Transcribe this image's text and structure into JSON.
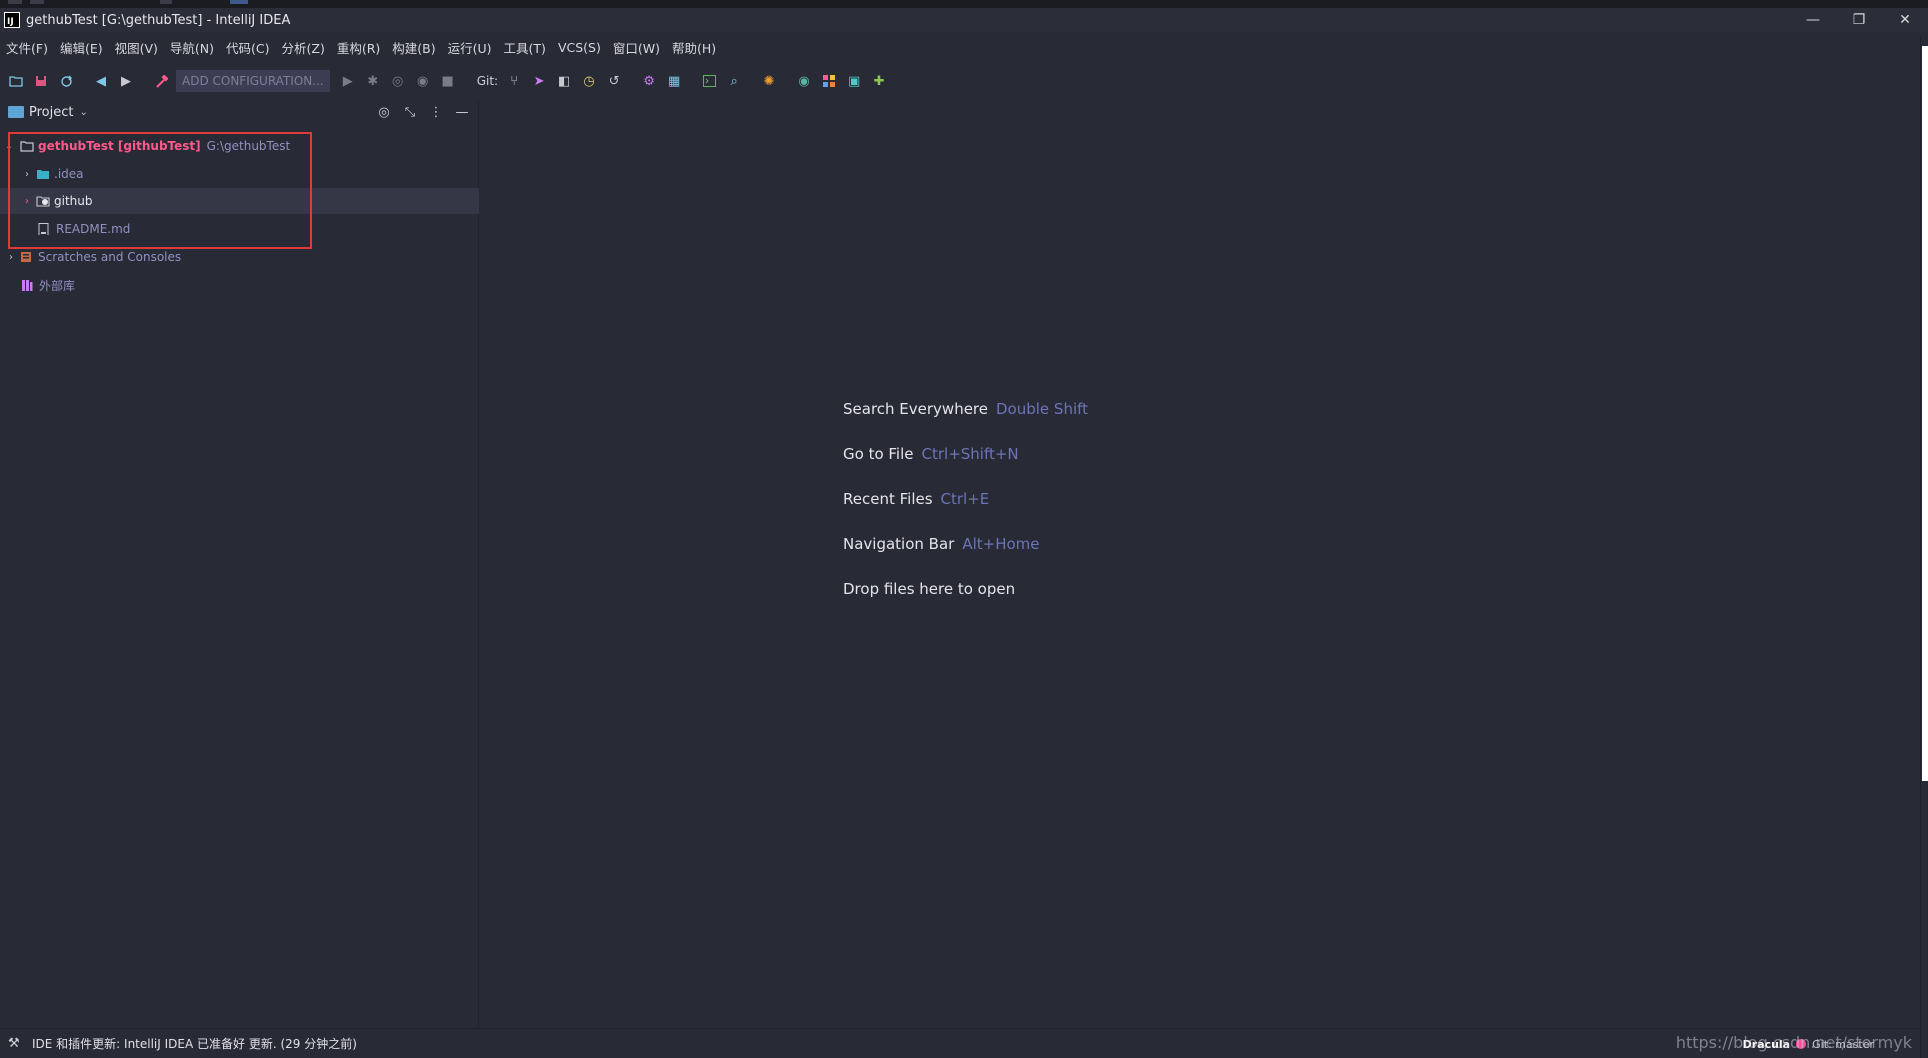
{
  "window": {
    "title": "gethubTest [G:\\gethubTest] - IntelliJ IDEA",
    "app_icon": "IJ",
    "controls": {
      "minimize": "—",
      "restore": "❐",
      "close": "✕"
    }
  },
  "menu": [
    "文件(F)",
    "编辑(E)",
    "视图(V)",
    "导航(N)",
    "代码(C)",
    "分析(Z)",
    "重构(R)",
    "构建(B)",
    "运行(U)",
    "工具(T)",
    "VCS(S)",
    "窗口(W)",
    "帮助(H)"
  ],
  "toolbar": {
    "add_configuration": "ADD CONFIGURATION...",
    "git_label": "Git:"
  },
  "project_panel": {
    "title": "Project",
    "tree": [
      {
        "name": "gethubTest [githubTest]",
        "path": "G:\\gethubTest"
      },
      {
        "name": ".idea"
      },
      {
        "name": "github"
      },
      {
        "name": "README.md"
      },
      {
        "name": "Scratches and Consoles"
      },
      {
        "name": "外部库"
      }
    ]
  },
  "welcome": [
    {
      "action": "Search Everywhere",
      "shortcut": "Double Shift"
    },
    {
      "action": "Go to File",
      "shortcut": "Ctrl+Shift+N"
    },
    {
      "action": "Recent Files",
      "shortcut": "Ctrl+E"
    },
    {
      "action": "Navigation Bar",
      "shortcut": "Alt+Home"
    },
    {
      "action": "Drop files here to open",
      "shortcut": ""
    }
  ],
  "status": {
    "message": "IDE 和插件更新: IntelliJ IDEA 已准备好 更新. (29 分钟之前)",
    "theme": "Dracula",
    "branch": "Git: master",
    "watermark": "https://blog.csdn.net/stormyk"
  },
  "colors": {
    "background": "#282a36",
    "highlight_box": "#e03a3a",
    "root_label": "#ff5a8a",
    "shortcut": "#6c75b6"
  }
}
